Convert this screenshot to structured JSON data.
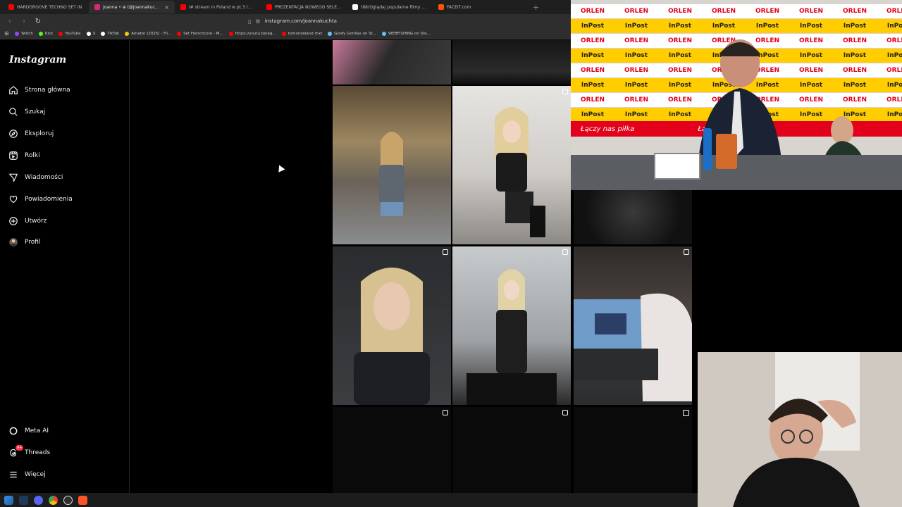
{
  "browser": {
    "tabs": [
      {
        "label": "HARDGROOVE TECHNO SET IN",
        "favicon_color": "#ff0000",
        "active": false
      },
      {
        "label": "joanna • ⊕ (@joannakuchta) • Z",
        "favicon_color": "#d62976",
        "active": true
      },
      {
        "label": "I# stream in Poland w pt.3 (Ultimate",
        "favicon_color": "#ff0000",
        "active": false
      },
      {
        "label": "PREZENTACJA NOWEGO SELEKC",
        "favicon_color": "#ff0000",
        "active": false
      },
      {
        "label": "(88)Oglądaj popularne filmy | TikTok",
        "favicon_color": "#ffffff",
        "active": false
      },
      {
        "label": "FACEIT.com",
        "favicon_color": "#ff5500",
        "active": false
      }
    ],
    "tab_close_glyph": "×",
    "new_tab_glyph": "+",
    "url": "instagram.com/joannakuchta",
    "bookmarks": [
      {
        "label": "Twitch",
        "color": "#9146ff"
      },
      {
        "label": "Kick",
        "color": "#53fc18"
      },
      {
        "label": "YouTube",
        "color": "#ff0000"
      },
      {
        "label": "X",
        "color": "#ffffff"
      },
      {
        "label": "TikTok",
        "color": "#ffffff"
      },
      {
        "label": "Amator (2025) - Fil...",
        "color": "#f5c518"
      },
      {
        "label": "Set Frenchcore - M...",
        "color": "#ff0000"
      },
      {
        "label": "https://youtu.be/aq...",
        "color": "#ff0000"
      },
      {
        "label": "tomorowland mxt",
        "color": "#ff0000"
      },
      {
        "label": "Goofy Gorillas on St...",
        "color": "#66c0f4"
      },
      {
        "label": "WEBFISHING on Ste...",
        "color": "#66c0f4"
      }
    ]
  },
  "instagram": {
    "logo": "Instagram",
    "nav": [
      {
        "label": "Strona główna",
        "icon": "home-icon"
      },
      {
        "label": "Szukaj",
        "icon": "search-icon"
      },
      {
        "label": "Eksploruj",
        "icon": "compass-icon"
      },
      {
        "label": "Rolki",
        "icon": "reels-icon"
      },
      {
        "label": "Wiadomości",
        "icon": "messages-icon"
      },
      {
        "label": "Powiadomienia",
        "icon": "heart-icon"
      },
      {
        "label": "Utwórz",
        "icon": "plus-icon"
      },
      {
        "label": "Profil",
        "icon": "avatar-icon"
      }
    ],
    "bottom_nav": [
      {
        "label": "Meta AI",
        "icon": "meta-ai-icon"
      },
      {
        "label": "Threads",
        "icon": "threads-icon",
        "badge": "9+"
      },
      {
        "label": "Więcej",
        "icon": "menu-icon"
      }
    ],
    "grid_posts": [
      {
        "subject": "pink hair, dark shirt with text",
        "badge": "none"
      },
      {
        "subject": "dj mixer top view",
        "badge": "none"
      },
      {
        "subject": "church interior, woman in grey tee",
        "badge": "none"
      },
      {
        "subject": "woman in black dress seated on floor",
        "badge": "multi"
      },
      {
        "subject": "black fluffy texture",
        "badge": "none"
      },
      {
        "subject": "blonde woman portrait",
        "badge": "multi"
      },
      {
        "subject": "woman at dj decks",
        "badge": "multi"
      },
      {
        "subject": "laptop showing anime",
        "badge": "multi"
      },
      {
        "subject": "dark",
        "badge": "multi"
      },
      {
        "subject": "dark",
        "badge": "multi"
      },
      {
        "subject": "dark",
        "badge": "reel"
      }
    ]
  },
  "press_conference": {
    "sponsors": [
      "ORLEN",
      "InPost"
    ],
    "slogan": "Łączy nas piłka",
    "accent_red": "#e3001b",
    "accent_yellow": "#ffcd00"
  },
  "taskbar": {
    "icons": [
      "windows-icon",
      "steam-icon",
      "discord-icon",
      "chrome-icon",
      "obs-icon",
      "brave-icon"
    ]
  }
}
